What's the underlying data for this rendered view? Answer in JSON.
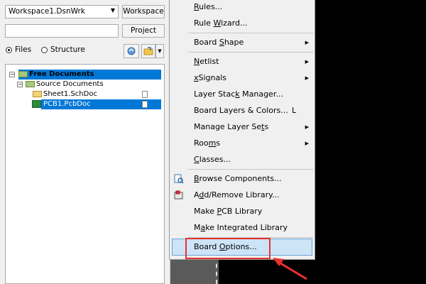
{
  "panel": {
    "workspace_combo": "Workspace1.DsnWrk",
    "workspace_button": "Workspace",
    "project_button": "Project",
    "radio_files": "Files",
    "radio_structure": "Structure",
    "selected_view": "Files"
  },
  "tree": {
    "root": "Free Documents",
    "source_folder": "Source Documents",
    "doc1": "Sheet1.SchDoc",
    "doc2": "PCB1.PcbDoc"
  },
  "menu": {
    "items": [
      {
        "label": "Rules...",
        "u": "R",
        "submenu": false
      },
      {
        "label": "Rule Wizard...",
        "u": "W",
        "submenu": false
      },
      {
        "label": "Board Shape",
        "u": "S",
        "submenu": true
      },
      {
        "label": "Netlist",
        "u": "N",
        "submenu": true
      },
      {
        "label": "xSignals",
        "u": "x",
        "submenu": true
      },
      {
        "label": "Layer Stack Manager...",
        "u": "k",
        "submenu": false
      },
      {
        "label": "Board Layers & Colors...",
        "shortcut": "L",
        "submenu": false
      },
      {
        "label": "Manage Layer Sets",
        "u": "t",
        "submenu": true
      },
      {
        "label": "Rooms",
        "u": "m",
        "submenu": true
      },
      {
        "label": "Classes...",
        "u": "C",
        "submenu": false
      },
      {
        "label": "Browse Components...",
        "u": "B",
        "submenu": false
      },
      {
        "label": "Add/Remove Library...",
        "u": "d",
        "submenu": false
      },
      {
        "label": "Make PCB Library",
        "u": "P",
        "submenu": false
      },
      {
        "label": "Make Integrated Library",
        "u": "a",
        "submenu": false
      },
      {
        "label": "Board Options...",
        "u": "O",
        "submenu": false
      }
    ],
    "highlighted": "Board Options..."
  },
  "colors": {
    "highlight": "#cde4f7",
    "annotation": "#e8312f",
    "tree_selection": "#0078d7"
  }
}
